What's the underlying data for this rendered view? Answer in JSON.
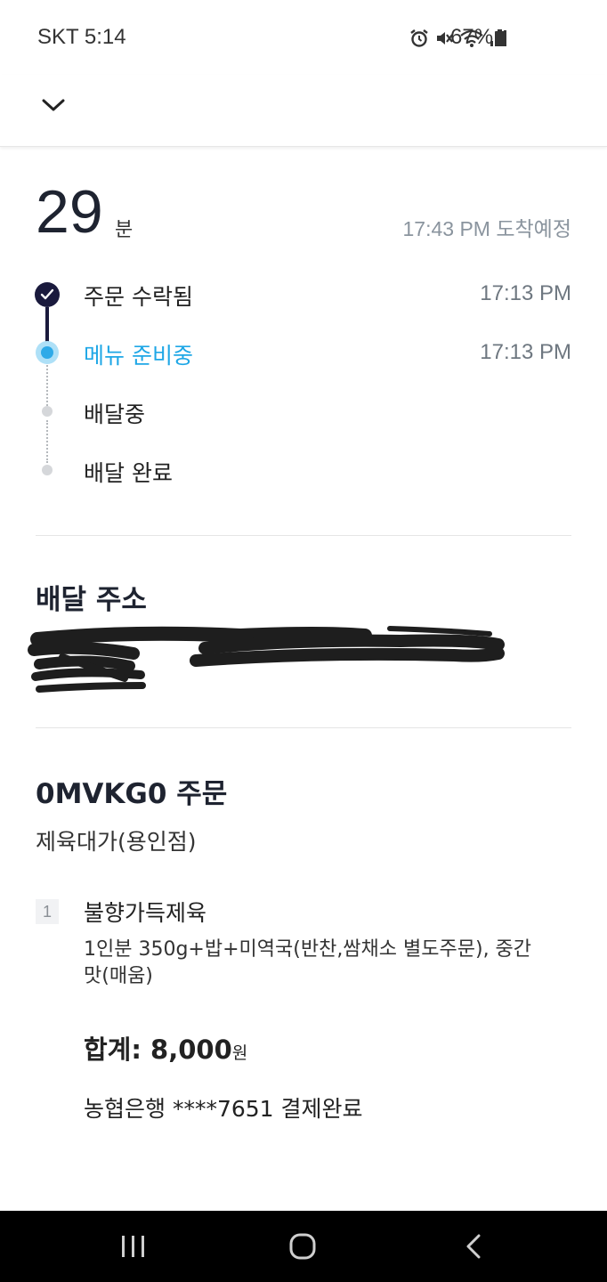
{
  "status_bar": {
    "carrier_time": "SKT 5:14",
    "battery_text": "67%",
    "icons": [
      "alarm-icon",
      "mute-icon",
      "wifi-icon",
      "signal-icon",
      "battery-icon"
    ]
  },
  "header": {
    "collapse_icon": "chevron-down-icon"
  },
  "eta": {
    "minutes": "29",
    "unit": "분",
    "arrival": "17:43 PM 도착예정"
  },
  "timeline": {
    "steps": [
      {
        "label": "주문 수락됨",
        "time": "17:13 PM",
        "state": "done"
      },
      {
        "label": "메뉴 준비중",
        "time": "17:13 PM",
        "state": "active"
      },
      {
        "label": "배달중",
        "time": "",
        "state": "pending"
      },
      {
        "label": "배달 완료",
        "time": "",
        "state": "pending"
      }
    ],
    "colors": {
      "done": "#1a1a3d",
      "active": "#2eaae8",
      "pending": "#d5d7da"
    }
  },
  "address": {
    "title": "배달 주소"
  },
  "order": {
    "title": "0MVKG0 주문",
    "shop": "제육대가(용인점)",
    "items": [
      {
        "qty": "1",
        "name": "불향가득제육",
        "options": "1인분 350g+밥+미역국(반찬,쌈채소 별도주문), 중간맛(매움)"
      }
    ],
    "total_label": "합계: 8,000",
    "total_unit": "원",
    "payment": "농협은행 ****7651 결제완료"
  },
  "nav_bar": {
    "buttons": [
      "recent-apps-icon",
      "home-icon",
      "back-icon"
    ]
  }
}
